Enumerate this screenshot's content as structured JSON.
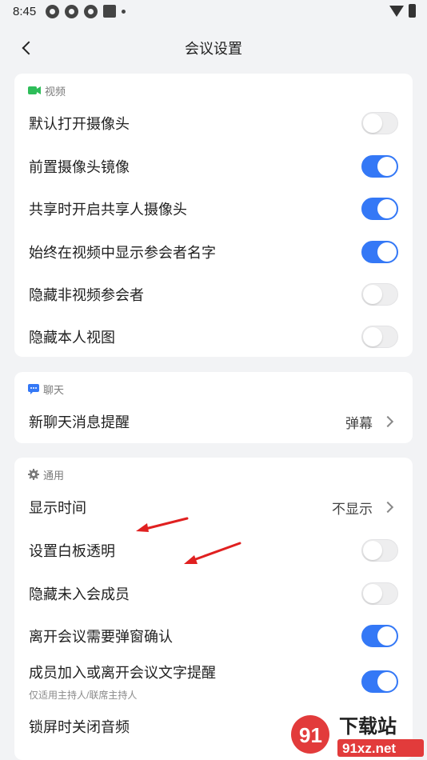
{
  "status_bar": {
    "time": "8:45"
  },
  "header": {
    "title": "会议设置"
  },
  "video": {
    "section_title": "视频",
    "accent": "#2ebd59",
    "rows": [
      {
        "label": "默认打开摄像头",
        "on": false
      },
      {
        "label": "前置摄像头镜像",
        "on": true
      },
      {
        "label": "共享时开启共享人摄像头",
        "on": true
      },
      {
        "label": "始终在视频中显示参会者名字",
        "on": true
      },
      {
        "label": "隐藏非视频参会者",
        "on": false
      },
      {
        "label": "隐藏本人视图",
        "on": false
      }
    ]
  },
  "chat": {
    "section_title": "聊天",
    "accent": "#3478f6",
    "rows": [
      {
        "label": "新聊天消息提醒",
        "value": "弹幕"
      }
    ]
  },
  "general": {
    "section_title": "通用",
    "rows": [
      {
        "label": "显示时间",
        "value": "不显示"
      },
      {
        "label": "设置白板透明",
        "on": false
      },
      {
        "label": "隐藏未入会成员",
        "on": false
      },
      {
        "label": "离开会议需要弹窗确认",
        "on": true
      },
      {
        "label": "成员加入或离开会议文字提醒",
        "sublabel": "仅适用主持人/联席主持人",
        "on": true
      },
      {
        "label": "锁屏时关闭音频"
      }
    ]
  },
  "watermark": {
    "logo_text": "下载站",
    "domain": "91xz.net"
  },
  "colors": {
    "toggle_on": "#3478f6",
    "annotation_arrow": "#e02020"
  }
}
